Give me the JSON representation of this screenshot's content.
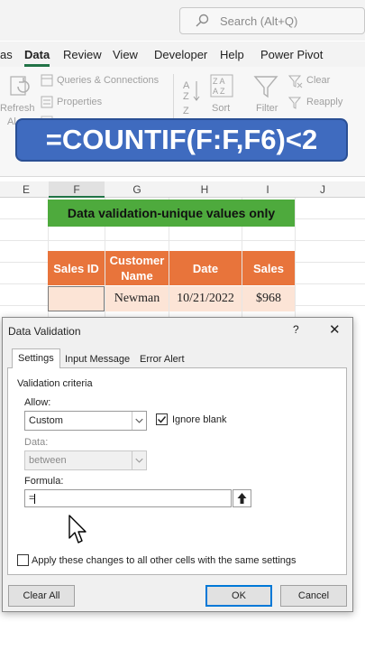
{
  "search": {
    "placeholder": "Search (Alt+Q)"
  },
  "menu_tabs": [
    {
      "label": "as"
    },
    {
      "label": "Data",
      "active": true
    },
    {
      "label": "Review"
    },
    {
      "label": "View"
    },
    {
      "label": "Developer"
    },
    {
      "label": "Help"
    },
    {
      "label": "Power Pivot"
    }
  ],
  "ribbon": {
    "refresh_label": "Refresh",
    "refresh_sub": "Al",
    "queries_label": "Queries & Connections",
    "properties_label": "Properties",
    "sort_label": "Sort",
    "filter_label": "Filter",
    "clear_label": "Clear",
    "reapply_label": "Reapply"
  },
  "formula_banner": "=COUNTIF(F:F,F6)<2",
  "columns": [
    "E",
    "F",
    "G",
    "H",
    "I",
    "J"
  ],
  "selected_column": "F",
  "sheet": {
    "title": "Data validation-unique values only",
    "headers": [
      "Sales ID",
      "Customer Name",
      "Date",
      "Sales"
    ],
    "rows": [
      {
        "sales_id": "",
        "customer": "Newman",
        "date": "10/21/2022",
        "sales": "$968"
      }
    ]
  },
  "dialog": {
    "title": "Data Validation",
    "help": "?",
    "close": "✕",
    "tabs": [
      "Settings",
      "Input Message",
      "Error Alert"
    ],
    "active_tab": "Settings",
    "section": "Validation criteria",
    "allow_label": "Allow:",
    "allow_value": "Custom",
    "ignore_blank_label": "Ignore blank",
    "ignore_blank_checked": true,
    "data_label": "Data:",
    "data_value": "between",
    "formula_label": "Formula:",
    "formula_value": "=",
    "apply_all_label": "Apply these changes to all other cells with the same settings",
    "apply_all_checked": false,
    "clear_all_label": "Clear All",
    "ok_label": "OK",
    "cancel_label": "Cancel"
  },
  "colors": {
    "accent_green": "#217346",
    "banner_blue": "#3f6bbf",
    "title_green": "#4eaa3d",
    "header_orange": "#e8743b",
    "row_peach": "#fce4d6"
  }
}
